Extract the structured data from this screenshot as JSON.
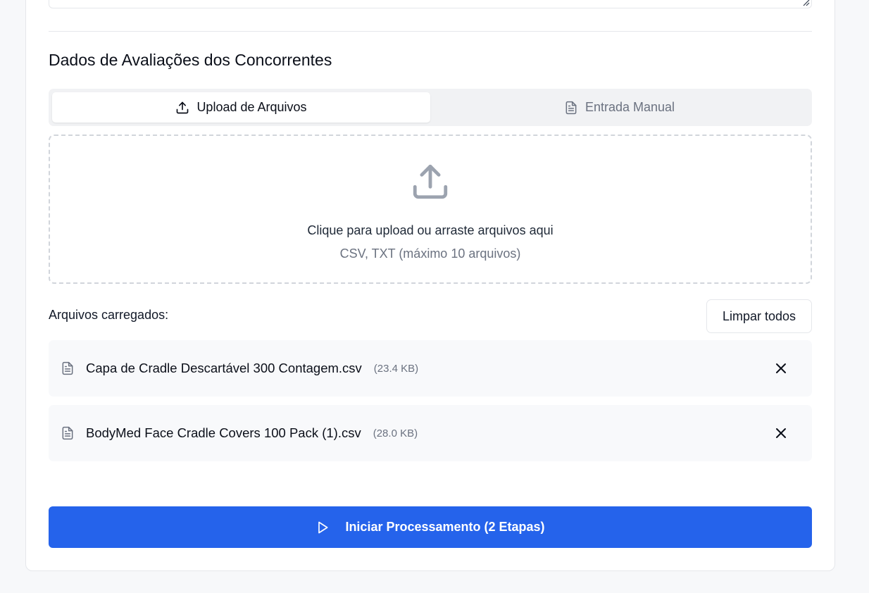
{
  "section": {
    "title": "Dados de Avaliações dos Concorrentes"
  },
  "tabs": [
    {
      "label": "Upload de Arquivos",
      "icon": "upload-icon",
      "active": true
    },
    {
      "label": "Entrada Manual",
      "icon": "document-icon",
      "active": false
    }
  ],
  "dropzone": {
    "main_text": "Clique para upload ou arraste arquivos aqui",
    "sub_text": "CSV, TXT (máximo 10 arquivos)",
    "icon": "upload-icon"
  },
  "files": {
    "label": "Arquivos carregados:",
    "clear_label": "Limpar todos",
    "items": [
      {
        "name": "Capa de Cradle Descartável 300 Contagem.csv",
        "size": "(23.4 KB)"
      },
      {
        "name": "BodyMed Face Cradle Covers 100 Pack (1).csv",
        "size": "(28.0 KB)"
      }
    ]
  },
  "actions": {
    "start_label": "Iniciar Processamento (2 Etapas)",
    "start_icon": "play-icon"
  },
  "colors": {
    "primary": "#2563eb",
    "muted_text": "#6b7280",
    "border": "#e5e7eb",
    "row_bg": "#f8f9fb"
  }
}
